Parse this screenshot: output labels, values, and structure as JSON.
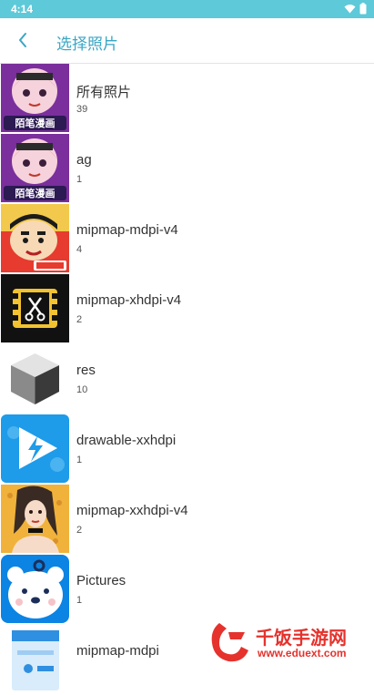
{
  "status_bar": {
    "time": "4:14"
  },
  "header": {
    "title": "选择照片"
  },
  "albums": [
    {
      "name": "所有照片",
      "count": "39",
      "thumb": "manga-girl-thumbnail",
      "caption": "陌笔漫画"
    },
    {
      "name": "ag",
      "count": "1",
      "thumb": "manga-girl-thumbnail",
      "caption": "陌笔漫画"
    },
    {
      "name": "mipmap-mdpi-v4",
      "count": "4",
      "thumb": "cartoon-boy-thumbnail"
    },
    {
      "name": "mipmap-xhdpi-v4",
      "count": "2",
      "thumb": "video-scissors-icon"
    },
    {
      "name": "res",
      "count": "10",
      "thumb": "gray-cube-icon"
    },
    {
      "name": "drawable-xxhdpi",
      "count": "1",
      "thumb": "lightning-app-icon"
    },
    {
      "name": "mipmap-xxhdpi-v4",
      "count": "2",
      "thumb": "woman-portrait-thumbnail"
    },
    {
      "name": "Pictures",
      "count": "1",
      "thumb": "white-bear-icon"
    },
    {
      "name": "mipmap-mdpi",
      "count": "",
      "thumb": "blue-document-icon"
    }
  ],
  "watermark": {
    "site_name": "千饭手游网",
    "url": "www.eduext.com"
  },
  "colors": {
    "status_bar": "#5ec9d8",
    "accent": "#3aa6c4",
    "watermark": "#e5322d"
  }
}
